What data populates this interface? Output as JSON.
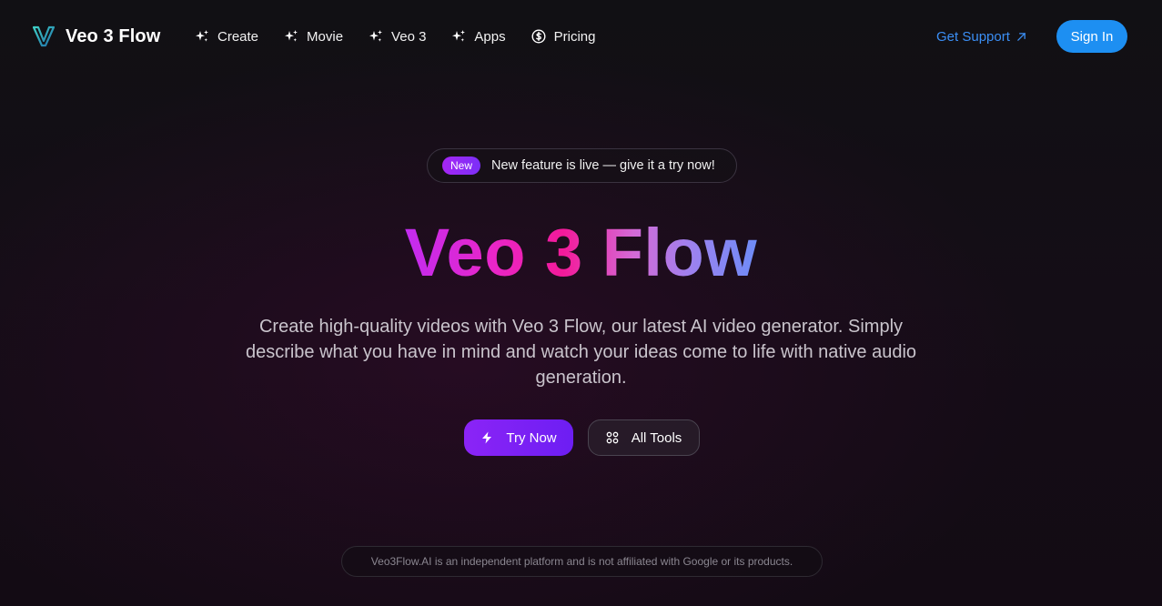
{
  "nav": {
    "brand": "Veo 3 Flow",
    "links": [
      {
        "label": "Create",
        "icon": "sparkles-icon"
      },
      {
        "label": "Movie",
        "icon": "sparkles-icon"
      },
      {
        "label": "Veo 3",
        "icon": "sparkles-icon"
      },
      {
        "label": "Apps",
        "icon": "sparkles-icon"
      },
      {
        "label": "Pricing",
        "icon": "dollar-circle-icon"
      }
    ],
    "support_label": "Get Support",
    "signin_label": "Sign In"
  },
  "announcement": {
    "badge": "New",
    "text": "New feature is live — give it a try now!"
  },
  "hero": {
    "title": "Veo 3 Flow",
    "description": "Create high-quality videos with Veo 3 Flow, our latest AI video generator. Simply describe what you have in mind and watch your ideas come to life with native audio generation.",
    "primary_cta": "Try Now",
    "secondary_cta": "All Tools"
  },
  "footer": {
    "disclaimer": "Veo3Flow.AI is an independent platform and is not affiliated with Google or its products."
  },
  "colors": {
    "accent_blue": "#1d8ff2",
    "link_blue": "#3b8ff5",
    "purple": "#8b24f6",
    "background": "#131016"
  }
}
